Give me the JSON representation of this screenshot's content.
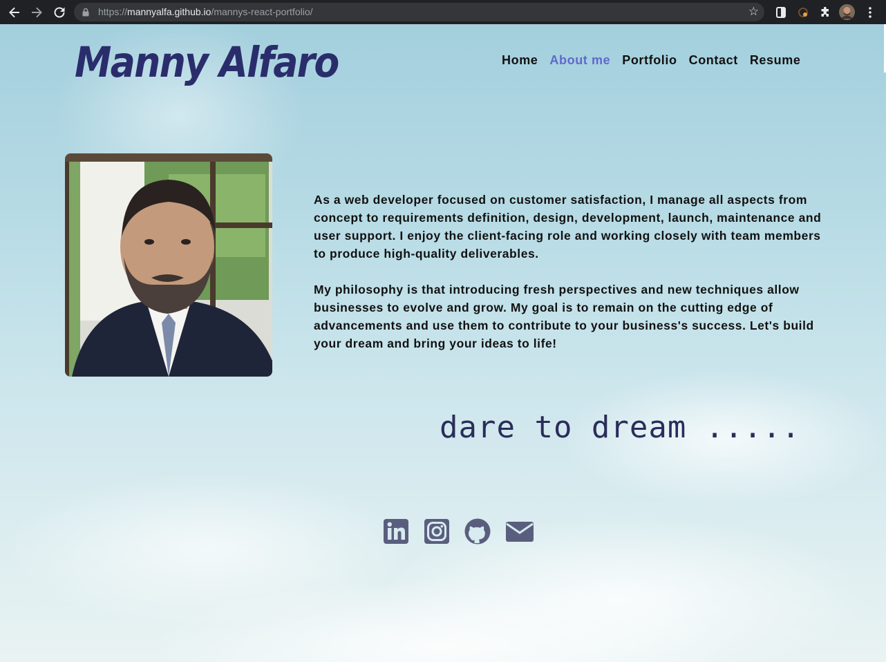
{
  "browser": {
    "url_scheme": "https://",
    "url_host": "mannyalfa.github.io",
    "url_path": "/mannys-react-portfolio/",
    "icons": [
      "back-icon",
      "forward-icon",
      "reload-icon",
      "lock-icon",
      "bookmark-star-icon",
      "extension-icon",
      "puzzle-icon",
      "profile-avatar",
      "menu-icon"
    ]
  },
  "header": {
    "logo": "Manny Alfaro",
    "nav": [
      {
        "label": "Home",
        "active": false
      },
      {
        "label": "About me",
        "active": true
      },
      {
        "label": "Portfolio",
        "active": false
      },
      {
        "label": "Contact",
        "active": false
      },
      {
        "label": "Resume",
        "active": false
      }
    ]
  },
  "about": {
    "paragraphs": [
      "As a web developer focused on customer satisfaction, I manage all aspects from concept to requirements definition, design, development, launch, maintenance and user support. I enjoy the client-facing role and working closely with team members to produce high-quality deliverables.",
      "My philosophy is that introducing fresh perspectives and new techniques allow businesses to evolve and grow. My goal is to remain on the cutting edge of advancements and use them to contribute to your business's success. Let's build your dream and bring your ideas to life!"
    ],
    "tagline": "dare to dream ....."
  },
  "social": [
    "linkedin-icon",
    "instagram-icon",
    "github-icon",
    "email-icon"
  ],
  "colors": {
    "brand": "#2a2d6b",
    "nav_active": "#6068cc",
    "icon": "#5a5e7e"
  }
}
